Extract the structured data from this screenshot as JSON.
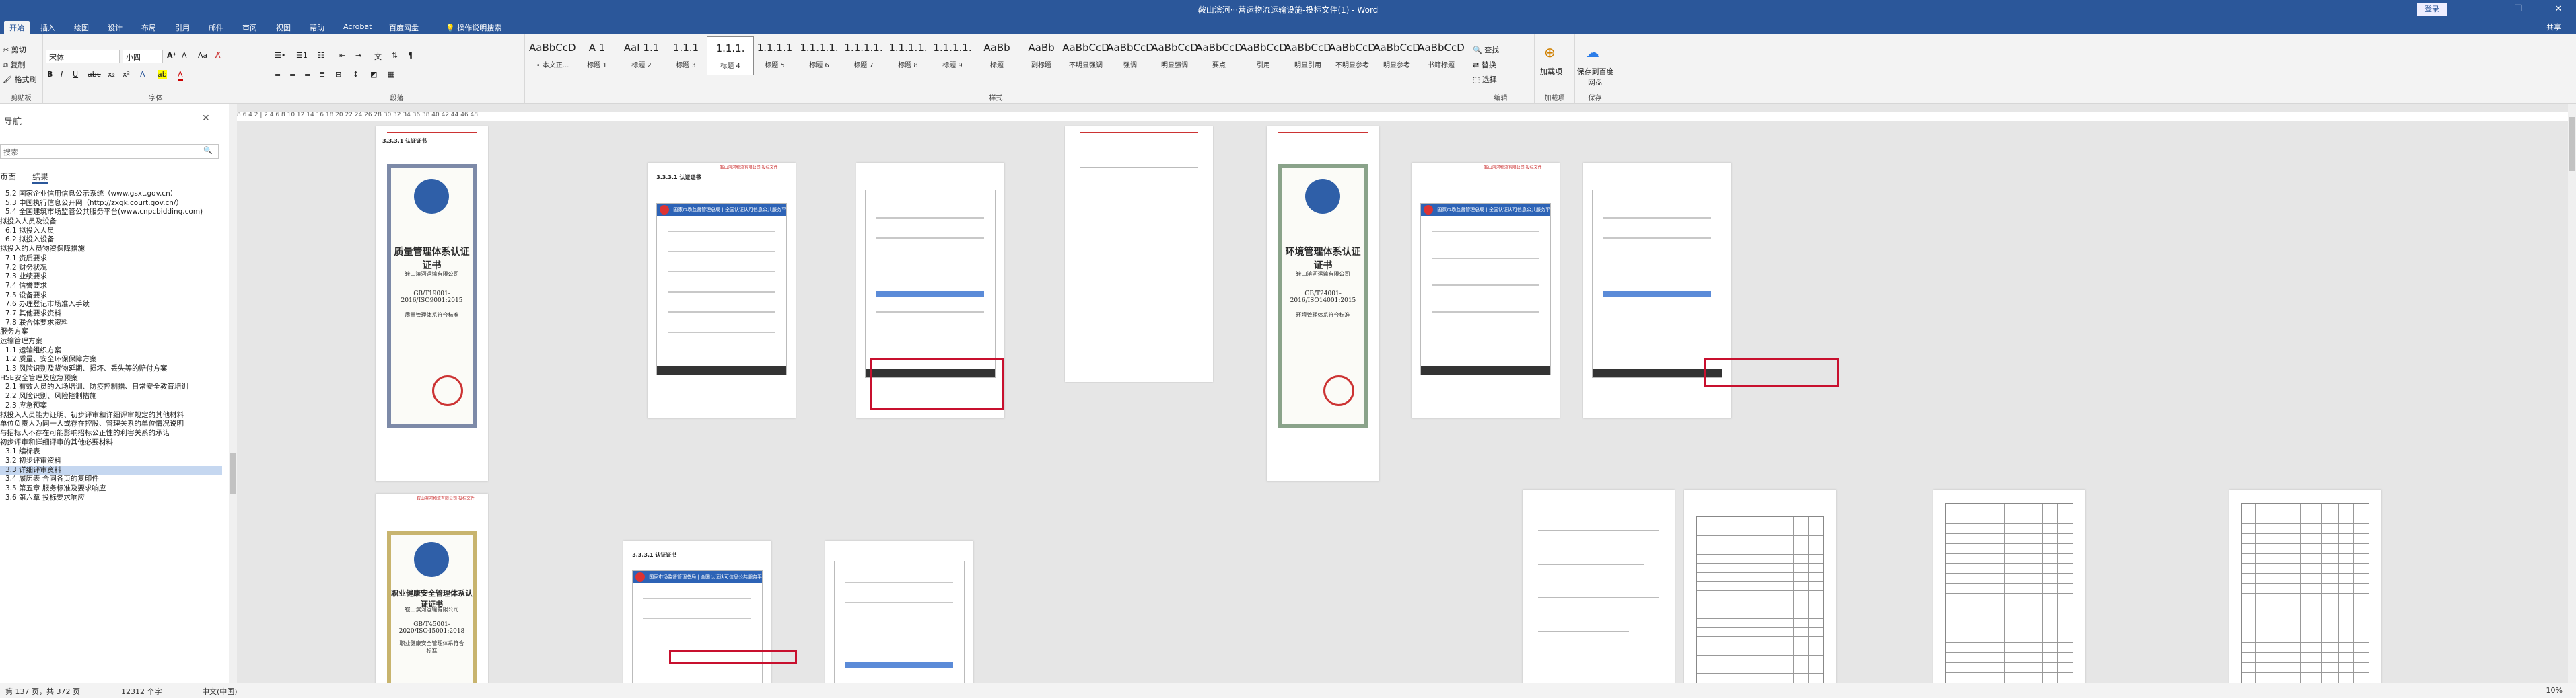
{
  "window": {
    "title": "鞍山滨河···营运物流运输设施-投标文件(1) - Word",
    "login": "登录",
    "minimize": "—",
    "restore": "❐",
    "close": "✕"
  },
  "tabs": [
    {
      "label": "开始",
      "active": true
    },
    {
      "label": "插入"
    },
    {
      "label": "绘图"
    },
    {
      "label": "设计"
    },
    {
      "label": "布局"
    },
    {
      "label": "引用"
    },
    {
      "label": "邮件"
    },
    {
      "label": "审阅"
    },
    {
      "label": "视图"
    },
    {
      "label": "帮助"
    },
    {
      "label": "Acrobat"
    },
    {
      "label": "百度网盘"
    },
    {
      "label": "操作说明搜索"
    }
  ],
  "share": "共享",
  "ribbon": {
    "clipboard": {
      "cut": "剪切",
      "copy": "复制",
      "format_painter": "格式刷",
      "label": "剪贴板"
    },
    "font": {
      "name": "宋体",
      "size": "小四",
      "label": "字体"
    },
    "paragraph": {
      "label": "段落"
    },
    "styles": {
      "label": "样式",
      "items": [
        {
          "sample": "AaBbCcDd",
          "name": "• 本文正..."
        },
        {
          "sample": "A 1",
          "name": "标题 1"
        },
        {
          "sample": "AaI 1.1",
          "name": "标题 2"
        },
        {
          "sample": "1.1.1",
          "name": "标题 3"
        },
        {
          "sample": "1.1.1.",
          "name": "标题 4",
          "selected": true
        },
        {
          "sample": "1.1.1.1",
          "name": "标题 5"
        },
        {
          "sample": "1.1.1.1.",
          "name": "标题 6"
        },
        {
          "sample": "1.1.1.1.",
          "name": "标题 7"
        },
        {
          "sample": "1.1.1.1.",
          "name": "标题 8"
        },
        {
          "sample": "1.1.1.1.",
          "name": "标题 9"
        },
        {
          "sample": "AaBb",
          "name": "标题"
        },
        {
          "sample": "AaBb",
          "name": "副标题"
        },
        {
          "sample": "AaBbCcD",
          "name": "不明显强调"
        },
        {
          "sample": "AaBbCcD",
          "name": "强调"
        },
        {
          "sample": "AaBbCcD",
          "name": "明显强调"
        },
        {
          "sample": "AaBbCcD",
          "name": "要点"
        },
        {
          "sample": "AaBbCcD",
          "name": "引用"
        },
        {
          "sample": "AaBbCcD",
          "name": "明显引用"
        },
        {
          "sample": "AaBbCcD",
          "name": "不明显参考"
        },
        {
          "sample": "AaBbCcD",
          "name": "明显参考"
        },
        {
          "sample": "AaBbCcD",
          "name": "书籍标题"
        }
      ]
    },
    "editing": {
      "find": "查找",
      "replace": "替换",
      "select": "选择",
      "label": "编辑"
    },
    "addin": {
      "name": "加载项",
      "label": "加载项"
    },
    "baidu": {
      "name": "保存到百度网盘",
      "label": "保存"
    }
  },
  "nav": {
    "title": "导航",
    "search_placeholder": "搜索",
    "tabs": [
      "页面",
      "结果"
    ],
    "items": [
      "5.2 国家企业信用信息公示系统（www.gsxt.gov.cn）",
      "5.3 中国执行信息公开网（http://zxgk.court.gov.cn/）",
      "5.4 全国建筑市场监管公共服务平台(www.cnpcbidding.com)",
      "拟投入人员及设备",
      "6.1 拟投入人员",
      "6.2 拟投入设备",
      "拟投入的人员物资保障措施",
      "7.1 资质要求",
      "7.2 财务状况",
      "7.3 业绩要求",
      "7.4 信誉要求",
      "7.5 设备要求",
      "7.6 办理登记市场准入手续",
      "7.7 其他要求资料",
      "7.8 联合体要求资料",
      "服务方案",
      "运输管理方案",
      "1.1 运输组织方案",
      "1.2 质量、安全环保保障方案",
      "1.3 风险识别及货物延期、损坏、丢失等的赔付方案",
      "HSE安全管理及应急预案",
      "2.1 有效人员的入场培训、防疫控制措、日常安全教育培训",
      "2.2 风险识别、风险控制措施",
      "2.3 应急预案",
      "拟投入人员能力证明、初步评审和详细评审规定的其他材料",
      "单位负责人为同一人或存在控股、管理关系的单位情况说明",
      "与招标人不存在可能影响招标公正性的利害关系的承诺",
      "初步评审和详细评审的其他必要材料",
      "3.1 编标表",
      "3.2 初步评审资料",
      "3.3 详细评审资料",
      "3.4 履历表 合同各页的复印件",
      "3.5 第五章 服务标准及要求响应",
      "3.6 第六章 投标要求响应"
    ],
    "selected_index": 30
  },
  "ruler": "8  6  4  2  |  2  4  6  8  10  12  14  16  18  20  22  24  26  28  30  32  34  36  38  40  42  44  46  48",
  "pages": {
    "header_text": "鞍山滨河物流有限公司 投标文件",
    "certs": [
      {
        "title": "质量管理体系认证证书",
        "company": "鞍山滨河运输有限公司",
        "standard": "GB/T19001-2016/ISO9001:2015",
        "scope": "质量管理体系符合标准"
      },
      {
        "title": "环境管理体系认证证书",
        "company": "鞍山滨河运输有限公司",
        "standard": "GB/T24001-2016/ISO14001:2015",
        "scope": "环境管理体系符合标准"
      },
      {
        "title": "职业健康安全管理体系认证证书",
        "company": "鞍山滨河运输有限公司",
        "standard": "GB/T45001-2020/ISO45001:2018",
        "scope": "职业健康安全管理体系符合标准"
      }
    ],
    "web_title": "国家市场监督管理总局 | 全国认证认可信息公共服务平台",
    "heading_prefix": "3.3.3.1 认证证书"
  },
  "status": {
    "page": "第 137 页，共 372 页",
    "words": "12312 个字",
    "lang": "中文(中国)",
    "zoom": "10%"
  }
}
